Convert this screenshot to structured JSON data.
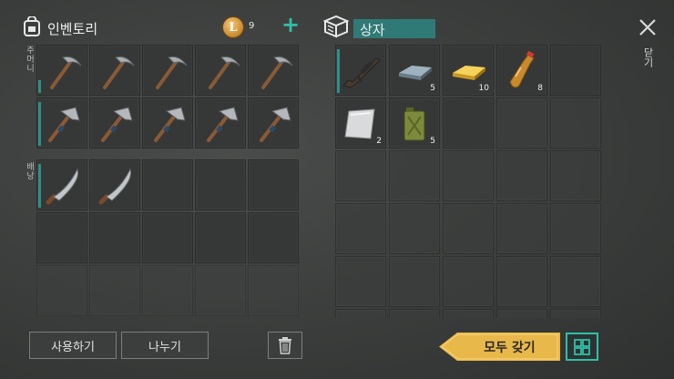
{
  "inventory": {
    "title": "인벤토리",
    "coin_symbol": "L",
    "coin_count": "9",
    "add_label": "+",
    "pocket_label": "주머니",
    "backpack_label": "배낭"
  },
  "box": {
    "title": "상자",
    "items": [
      {
        "name": "rifle",
        "qty": ""
      },
      {
        "name": "iron-ingot",
        "qty": "5"
      },
      {
        "name": "gold-ingot",
        "qty": "10"
      },
      {
        "name": "bottle",
        "qty": "8"
      },
      {
        "name": "metal-plate",
        "qty": "2"
      },
      {
        "name": "jerrycan",
        "qty": "5"
      }
    ]
  },
  "actions": {
    "use": "사용하기",
    "split": "나누기",
    "take_all": "모두 갖기",
    "close": "닫기"
  },
  "colors": {
    "accent": "#2fbfa8",
    "title_bar": "#2f7a76",
    "take_all": "#e9b84a"
  },
  "icons": {
    "inventory": "backpack-icon",
    "box": "crate-icon",
    "trash": "trash-icon",
    "close": "close-icon",
    "layout": "grid-icon"
  }
}
